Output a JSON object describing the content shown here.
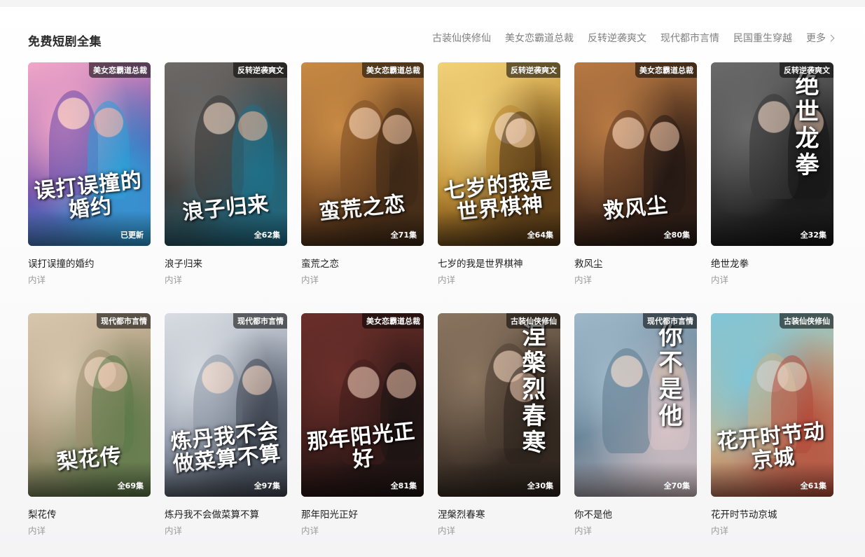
{
  "section": {
    "title": "免费短剧全集",
    "categories": [
      "古装仙侠修仙",
      "美女恋霸道总裁",
      "反转逆袭爽文",
      "现代都市言情",
      "民国重生穿越"
    ],
    "more_label": "更多"
  },
  "dramas": [
    {
      "title": "误打误撞的婚约",
      "cover_text": "误打误撞的婚约",
      "tag": "美女恋霸道总裁",
      "episodes": "已更新",
      "subtitle": "内详",
      "colors": [
        "#f3a7c8",
        "#6b4aa8",
        "#2d9fd6"
      ]
    },
    {
      "title": "浪子归来",
      "cover_text": "浪子归来",
      "tag": "反转逆袭爽文",
      "episodes": "全62集",
      "subtitle": "内详",
      "colors": [
        "#6d6a68",
        "#3a3836",
        "#1f6f88"
      ]
    },
    {
      "title": "蛮荒之恋",
      "cover_text": "蛮荒之恋",
      "tag": "美女恋霸道总裁",
      "episodes": "全71集",
      "subtitle": "内详",
      "colors": [
        "#c98b45",
        "#7a4a22",
        "#3b2716"
      ]
    },
    {
      "title": "七岁的我是世界棋神",
      "cover_text": "七岁的我是世界棋神",
      "tag": "反转逆袭爽文",
      "episodes": "全64集",
      "subtitle": "内详",
      "colors": [
        "#f2d27a",
        "#b8862e",
        "#4a3014"
      ]
    },
    {
      "title": "救风尘",
      "cover_text": "救风尘",
      "tag": "美女恋霸道总裁",
      "episodes": "全80集",
      "subtitle": "内详",
      "colors": [
        "#b87a44",
        "#5d3820",
        "#241814"
      ]
    },
    {
      "title": "绝世龙拳",
      "cover_text": "绝世龙拳",
      "tag": "反转逆袭爽文",
      "episodes": "全32集",
      "subtitle": "内详",
      "colors": [
        "#6b6b6b",
        "#333333",
        "#161616"
      ]
    },
    {
      "title": "梨花传",
      "cover_text": "梨花传",
      "tag": "现代都市言情",
      "episodes": "全69集",
      "subtitle": "内详",
      "colors": [
        "#d8c7ae",
        "#a08e70",
        "#5c7a4a"
      ]
    },
    {
      "title": "炼丹我不会做菜算不算",
      "cover_text": "炼丹我不会做菜算不算",
      "tag": "现代都市言情",
      "episodes": "全97集",
      "subtitle": "内详",
      "colors": [
        "#d9dde3",
        "#8c96a6",
        "#3f4652"
      ]
    },
    {
      "title": "那年阳光正好",
      "cover_text": "那年阳光正好",
      "tag": "美女恋霸道总裁",
      "episodes": "全81集",
      "subtitle": "内详",
      "colors": [
        "#6a2f2a",
        "#3e1c1a",
        "#1c1413"
      ]
    },
    {
      "title": "涅槃烈春寒",
      "cover_text": "涅槃烈春寒",
      "tag": "古装仙侠修仙",
      "episodes": "全30集",
      "subtitle": "内详",
      "colors": [
        "#8a7560",
        "#4d3e32",
        "#2b221c"
      ]
    },
    {
      "title": "你不是他",
      "cover_text": "你不是他",
      "tag": "现代都市言情",
      "episodes": "全70集",
      "subtitle": "内详",
      "colors": [
        "#9fb8c9",
        "#5e7a8e",
        "#d8c4c8"
      ]
    },
    {
      "title": "花开时节动京城",
      "cover_text": "花开时节动京城",
      "tag": "古装仙侠修仙",
      "episodes": "全61集",
      "subtitle": "内详",
      "colors": [
        "#7fc6d9",
        "#c8b48a",
        "#b34a3a"
      ]
    }
  ]
}
